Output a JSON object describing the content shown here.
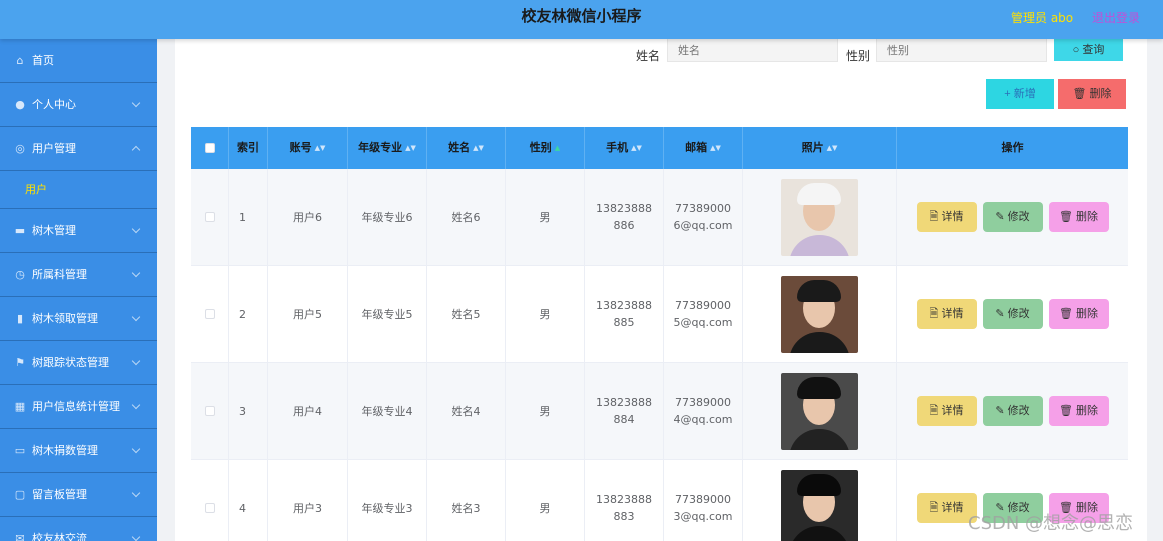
{
  "header": {
    "title": "校友林微信小程序",
    "admin": "管理员 abo",
    "logout": "退出登录"
  },
  "sidebar": {
    "items": [
      {
        "label": "首页",
        "icon": "home-icon",
        "glyph": "⌂",
        "arrow": false
      },
      {
        "label": "个人中心",
        "icon": "user-icon",
        "glyph": "●",
        "arrow": true
      },
      {
        "label": "用户管理",
        "icon": "circle-icon",
        "glyph": "◎",
        "arrow": true,
        "expanded": true
      },
      {
        "label": "树木管理",
        "icon": "message-icon",
        "glyph": "▬",
        "arrow": true
      },
      {
        "label": "所属科管理",
        "icon": "compass-icon",
        "glyph": "◷",
        "arrow": true
      },
      {
        "label": "树木领取管理",
        "icon": "chart-icon",
        "glyph": "▮",
        "arrow": true
      },
      {
        "label": "树跟踪状态管理",
        "icon": "flag-icon",
        "glyph": "⚑",
        "arrow": true
      },
      {
        "label": "用户信息统计管理",
        "icon": "grid-icon",
        "glyph": "▦",
        "arrow": true
      },
      {
        "label": "树木捐数管理",
        "icon": "monitor-icon",
        "glyph": "▭",
        "arrow": true
      },
      {
        "label": "留言板管理",
        "icon": "chat-icon",
        "glyph": "▢",
        "arrow": true
      },
      {
        "label": "校友林交流",
        "icon": "mail-icon",
        "glyph": "✉",
        "arrow": true
      }
    ],
    "sub_item": "用户"
  },
  "search": {
    "name_label": "姓名",
    "name_placeholder": "姓名",
    "gender_label": "性别",
    "gender_placeholder": "性别",
    "query_label": "○ 查询"
  },
  "toolbar": {
    "add_label": "+ 新增",
    "delete_label": "🗑 删除"
  },
  "table": {
    "headers": {
      "index": "索引",
      "account": "账号",
      "major": "年级专业",
      "name": "姓名",
      "gender": "性别",
      "phone": "手机",
      "email": "邮箱",
      "photo": "照片",
      "actions": "操作"
    },
    "rows": [
      {
        "index": "1",
        "account": "用户6",
        "major": "年级专业6",
        "name": "姓名6",
        "gender": "男",
        "phone": "13823888886",
        "email": "773890006@qq.com"
      },
      {
        "index": "2",
        "account": "用户5",
        "major": "年级专业5",
        "name": "姓名5",
        "gender": "男",
        "phone": "13823888885",
        "email": "773890005@qq.com"
      },
      {
        "index": "3",
        "account": "用户4",
        "major": "年级专业4",
        "name": "姓名4",
        "gender": "男",
        "phone": "13823888884",
        "email": "773890004@qq.com"
      },
      {
        "index": "4",
        "account": "用户3",
        "major": "年级专业3",
        "name": "姓名3",
        "gender": "男",
        "phone": "13823888883",
        "email": "773890003@qq.com"
      }
    ],
    "actions": {
      "detail": "🗎 详情",
      "edit": "✎ 修改",
      "remove": "🗑 删除"
    }
  },
  "watermark": "CSDN @想念@思恋"
}
